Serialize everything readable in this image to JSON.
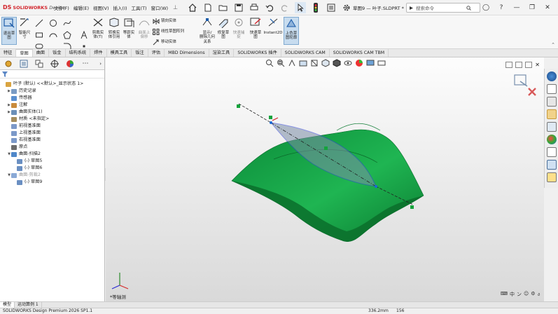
{
  "app": {
    "brand_prefix": "SOLID",
    "brand_bold": "WORKS",
    "brand_suffix": "Design",
    "document_title": "草图9 — 叶子.SLDPRT *"
  },
  "menus": [
    "文件(F)",
    "编辑(E)",
    "视图(V)",
    "插入(I)",
    "工具(T)",
    "窗口(W)"
  ],
  "search": {
    "placeholder": "搜索命令"
  },
  "ribbon": {
    "buttons": [
      {
        "label1": "退出草",
        "label2": "图",
        "icon": "exit-sketch-icon"
      },
      {
        "label1": "智能尺",
        "label2": "寸",
        "icon": "smart-dimension-icon"
      },
      {
        "label1": "剪裁实",
        "label2": "体(T)",
        "icon": "trim-entities-icon"
      },
      {
        "label1": "转换实",
        "label2": "体引用",
        "icon": "convert-entities-icon"
      },
      {
        "label1": "等距实",
        "label2": "体",
        "icon": "offset-entities-icon"
      },
      {
        "label1": "曲面上",
        "label2": "偏移",
        "icon": "offset-on-surface-icon"
      },
      {
        "label1": "显示/",
        "label2": "删除几何关系",
        "icon": "display-relations-icon"
      },
      {
        "label1": "修复草",
        "label2": "图",
        "icon": "repair-sketch-icon"
      },
      {
        "label1": "快速捕",
        "label2": "捉",
        "icon": "quick-snaps-icon"
      },
      {
        "label1": "快速草",
        "label2": "图",
        "icon": "rapid-sketch-icon"
      },
      {
        "label1": "Instant2D",
        "label2": "",
        "icon": "instant2d-icon"
      },
      {
        "label1": "上色草",
        "label2": "图轮廓",
        "icon": "shaded-sketch-icon"
      }
    ],
    "mirror": "镜向实体",
    "linear_pattern": "线性草图阵列",
    "move": "移动实体"
  },
  "tabs": [
    "特征",
    "草图",
    "曲面",
    "钣金",
    "结构系统",
    "焊件",
    "模具工具",
    "钣注",
    "评估",
    "MBD Dimensions",
    "渲染工具",
    "SOLIDWORKS 插件",
    "SOLIDWORKS CAM",
    "SOLIDWORKS CAM TBM"
  ],
  "active_tab": "草图",
  "tree": [
    {
      "text": "叶子 (默认) <<默认>_显示状态 1>",
      "indent": 0,
      "arrow": "",
      "color": "#d9a441",
      "dim": false
    },
    {
      "text": "历史记录",
      "indent": 1,
      "arrow": "▶",
      "color": "#7a9bc4",
      "dim": false
    },
    {
      "text": "传感器",
      "indent": 1,
      "arrow": "",
      "color": "#5a8fd0",
      "dim": false
    },
    {
      "text": "注解",
      "indent": 1,
      "arrow": "▶",
      "color": "#c98b3c",
      "dim": false
    },
    {
      "text": "曲面实体(1)",
      "indent": 1,
      "arrow": "▶",
      "color": "#6b8fb8",
      "dim": false
    },
    {
      "text": "材质 <未指定>",
      "indent": 1,
      "arrow": "",
      "color": "#a48d5e",
      "dim": false
    },
    {
      "text": "前视基准面",
      "indent": 1,
      "arrow": "",
      "color": "#7c99c9",
      "dim": false
    },
    {
      "text": "上视基准面",
      "indent": 1,
      "arrow": "",
      "color": "#7c99c9",
      "dim": false
    },
    {
      "text": "右视基准面",
      "indent": 1,
      "arrow": "",
      "color": "#7c99c9",
      "dim": false
    },
    {
      "text": "原点",
      "indent": 1,
      "arrow": "",
      "color": "#6c6c6c",
      "dim": false
    },
    {
      "text": "曲面-扫描2",
      "indent": 1,
      "arrow": "▼",
      "color": "#4f87c9",
      "dim": false
    },
    {
      "text": "(-) 草图5",
      "indent": 2,
      "arrow": "",
      "color": "#6a8fc2",
      "dim": false
    },
    {
      "text": "(-) 草图6",
      "indent": 2,
      "arrow": "",
      "color": "#6a8fc2",
      "dim": false
    },
    {
      "text": "曲面-剪裁2",
      "indent": 1,
      "arrow": "▼",
      "color": "#8aa9d6",
      "dim": true
    },
    {
      "text": "(-) 草图9",
      "indent": 2,
      "arrow": "",
      "color": "#6a8fc2",
      "dim": false
    }
  ],
  "viewport": {
    "view_label": "*等轴测"
  },
  "bottom_tabs": [
    "模型",
    "运动算例 1"
  ],
  "status": {
    "product": "SOLIDWORKS Design Premium 2026 SP1.1",
    "coord1": "336.2mm",
    "coord2": "156"
  },
  "colors": {
    "surface_green": "#1aa34a",
    "surface_dark": "#0d7a35",
    "trim_blue": "#3b4fd6",
    "trim_fill": "#7c8fa6",
    "accent": "#d2232a"
  }
}
